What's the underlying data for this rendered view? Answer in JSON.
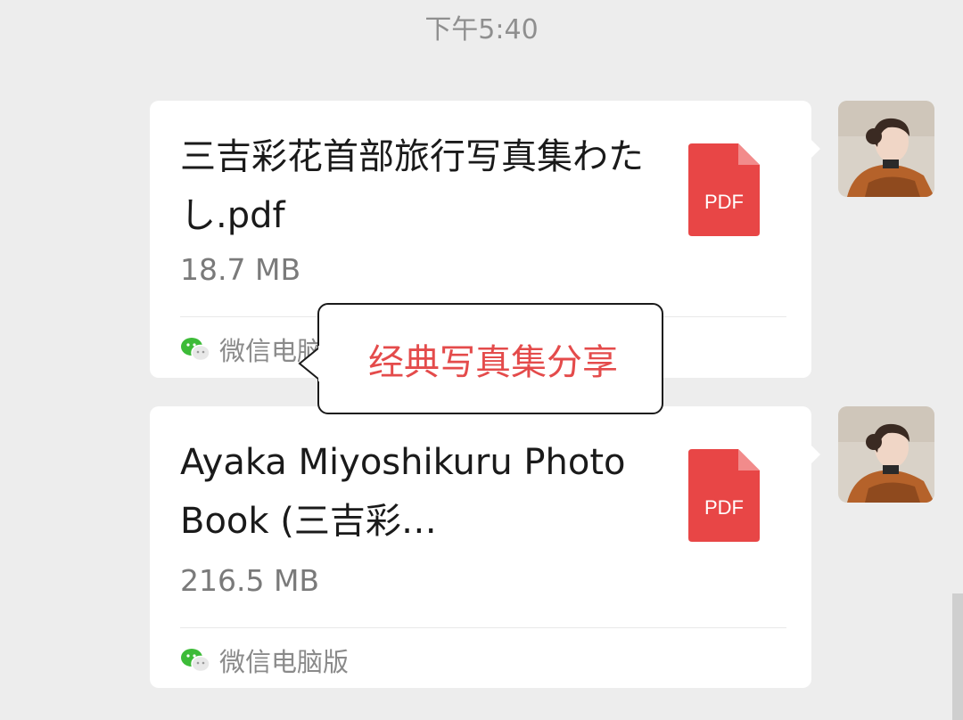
{
  "chat": {
    "timestamp": "下午5:40",
    "messages": [
      {
        "filename": "三吉彩花首部旅行写真集わたし.pdf",
        "size": "18.7 MB",
        "source": "微信电脑版",
        "file_type": "PDF"
      },
      {
        "filename": "Ayaka Miyoshikuru Photo Book (三吉彩…",
        "size": "216.5 MB",
        "source": "微信电脑版",
        "file_type": "PDF"
      }
    ]
  },
  "annotation": {
    "text": "经典写真集分享",
    "color": "#e44b4b"
  },
  "colors": {
    "pdf_red": "#e84646",
    "wechat_green": "#3dbb38",
    "background": "#ededed"
  }
}
